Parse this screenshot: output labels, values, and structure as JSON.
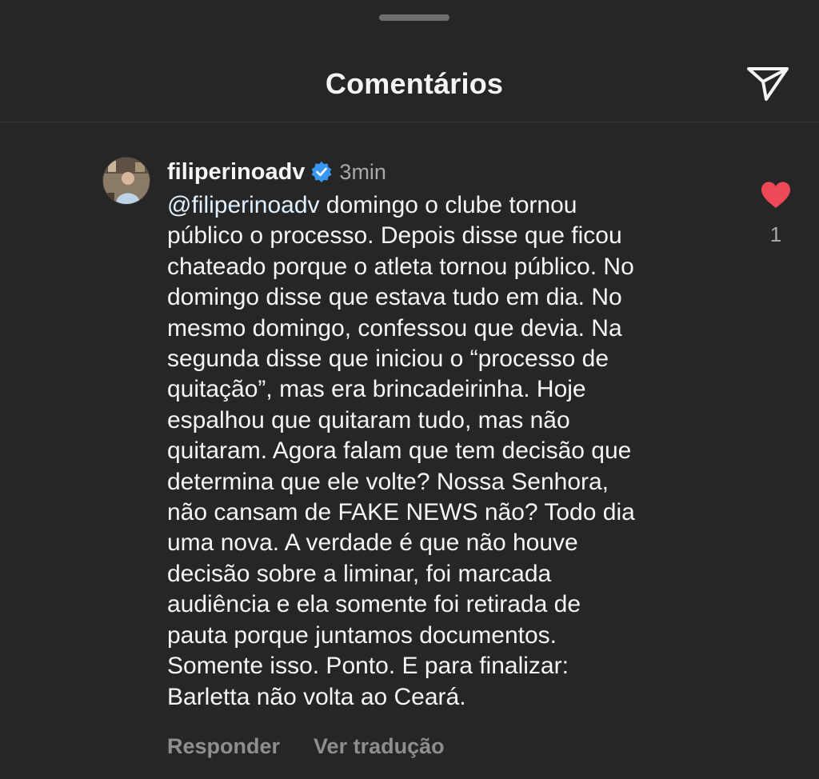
{
  "sheet": {
    "title": "Comentários",
    "share_icon": "send-paper-plane-icon"
  },
  "comment": {
    "username": "filiperinoadv",
    "verified": true,
    "verified_icon": "verified-badge-icon",
    "timestamp": "3min",
    "mention": "@filiperinoadv",
    "text_lines": [
      " domingo o clube tornou",
      "público o processo. Depois disse que ficou",
      "chateado porque o atleta tornou público. No",
      "domingo disse que estava tudo em dia. No",
      "mesmo domingo, confessou que devia. Na",
      "segunda disse que iniciou o “processo de",
      "quitação”, mas era brincadeirinha. Hoje",
      "espalhou que quitaram tudo, mas não",
      "quitaram. Agora falam que tem decisão que",
      "determina que ele volte? Nossa Senhora,",
      "não cansam de FAKE NEWS não? Todo dia",
      "uma nova. A verdade é que não houve",
      "decisão sobre a liminar, foi marcada",
      "audiência e ela somente foi retirada de",
      "pauta porque juntamos documentos.",
      "Somente isso. Ponto. E para finalizar:",
      "Barletta não volta ao Ceará."
    ],
    "reply_label": "Responder",
    "translate_label": "Ver tradução",
    "like_icon": "heart-filled-icon",
    "like_count": "1",
    "liked": true
  },
  "colors": {
    "background": "#262626",
    "text": "#f5f5f5",
    "secondary_text": "#a8a8a8",
    "mention": "#e0f1ff",
    "heart": "#ed4956",
    "verified": "#3897f0"
  }
}
